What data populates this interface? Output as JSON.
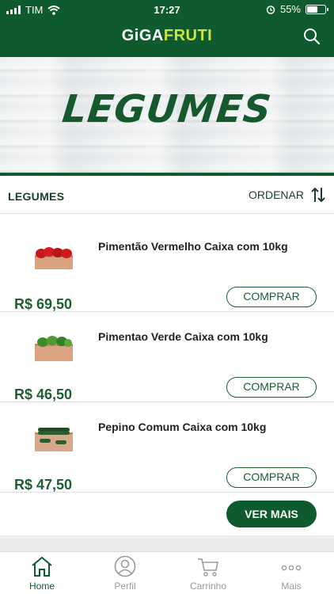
{
  "status": {
    "carrier": "TIM",
    "time": "17:27",
    "battery": "55%",
    "battery_level": 0.55
  },
  "header": {
    "brand_part1": "GiGA",
    "brand_part2": "FRUTI"
  },
  "banner": {
    "title": "LEGUMES"
  },
  "section": {
    "title": "LEGUMES",
    "order_label": "ORDENAR"
  },
  "products": [
    {
      "name": "Pimentão Vermelho Caixa com 10kg",
      "price": "R$  69,50",
      "buy_label": "COMPRAR"
    },
    {
      "name": "Pimentao Verde Caixa com 10kg",
      "price": "R$  46,50",
      "buy_label": "COMPRAR"
    },
    {
      "name": "Pepino Comum Caixa com 10kg",
      "price": "R$  47,50",
      "buy_label": "COMPRAR"
    }
  ],
  "more_label": "VER MAIS",
  "tabs": [
    {
      "label": "Home",
      "icon": "home-icon"
    },
    {
      "label": "Perfil",
      "icon": "profile-icon"
    },
    {
      "label": "Carrinho",
      "icon": "cart-icon"
    },
    {
      "label": "Mais",
      "icon": "more-icon"
    }
  ],
  "colors": {
    "brand_green": "#0f5a2e",
    "accent_lime": "#c9e34a",
    "price_green": "#1f5d35"
  }
}
